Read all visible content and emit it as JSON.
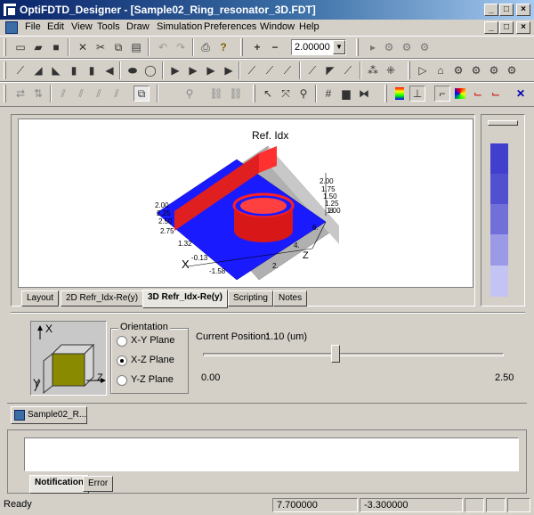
{
  "window": {
    "app_name": "OptiFDTD_Designer",
    "document": "[Sample02_Ring_resonator_3D.FDT]",
    "title": "OptiFDTD_Designer - [Sample02_Ring_resonator_3D.FDT]",
    "buttons": {
      "minimize": "_",
      "maximize": "□",
      "close": "×"
    }
  },
  "menu": [
    "File",
    "Edit",
    "View",
    "Tools",
    "Draw",
    "Simulation",
    "Preferences",
    "Window",
    "Help"
  ],
  "toolbar": {
    "zoom_value": "2.00000",
    "plus": "+",
    "minus": "−"
  },
  "plot": {
    "title": "Ref. Idx",
    "axis_x_label": "X",
    "axis_z_label": "Z",
    "ticks_right": [
      "2.00",
      "1.75",
      "1.50",
      "1.25",
      "1.00"
    ],
    "ticks_left": [
      "2.00",
      "2.25",
      "2.50",
      "2.75"
    ],
    "ticks_x": [
      "1.32",
      "-0.13",
      "-1.58"
    ],
    "ticks_z": [
      "8.",
      "6.",
      "4.",
      "2."
    ],
    "colors": {
      "high": "#ff0000",
      "low": "#0000ff",
      "wall": "#a0a0a0"
    }
  },
  "view_tabs": [
    {
      "label": "Layout",
      "active": false
    },
    {
      "label": "2D Refr_Idx-Re(y)",
      "active": false
    },
    {
      "label": "3D Refr_Idx-Re(y)",
      "active": true
    },
    {
      "label": "Scripting",
      "active": false
    },
    {
      "label": "Notes",
      "active": false
    }
  ],
  "scale_bar": {
    "colors": [
      "#4040cc",
      "#5050d0",
      "#7070d8",
      "#9a9ae6",
      "#c4c4f4"
    ]
  },
  "orientation": {
    "title": "Orientation",
    "options": [
      {
        "label": "X-Y Plane",
        "selected": false
      },
      {
        "label": "X-Z Plane",
        "selected": true
      },
      {
        "label": "Y-Z Plane",
        "selected": false
      }
    ],
    "cube_labels": {
      "x": "X",
      "y": "Y",
      "z": "Z"
    }
  },
  "position": {
    "label": "Current Position:",
    "value": "1.10 (um)",
    "min": "0.00",
    "max": "2.50",
    "fraction": 0.44
  },
  "doc_tab": {
    "label": "Sample02_R..."
  },
  "output_tabs": [
    {
      "label": "Notification",
      "active": true
    },
    {
      "label": "Error",
      "active": false
    }
  ],
  "status": {
    "text": "Ready",
    "x": "7.700000",
    "y": "-3.300000"
  }
}
